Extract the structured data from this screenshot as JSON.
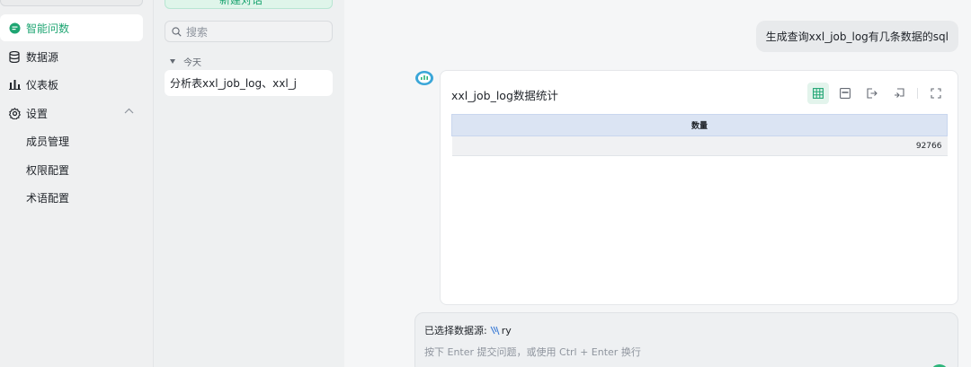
{
  "sidebar": {
    "items": [
      {
        "label": "智能问数",
        "icon": "chat-bubble-icon",
        "active": true
      },
      {
        "label": "数据源",
        "icon": "database-icon"
      },
      {
        "label": "仪表板",
        "icon": "bar-chart-icon"
      },
      {
        "label": "设置",
        "icon": "gear-icon"
      }
    ],
    "settings_sub": [
      "成员管理",
      "权限配置",
      "术语配置"
    ]
  },
  "history": {
    "new_chat_label": "新建对话",
    "search_placeholder": "搜索",
    "group_today": "今天",
    "items": [
      "分析表xxl_job_log、xxl_j"
    ]
  },
  "chat": {
    "user_message": "生成查询xxl_job_log有几条数据的sql",
    "answer": {
      "title": "xxl_job_log数据统计",
      "tools": [
        "table-view-icon",
        "sql-icon",
        "export-icon",
        "insert-dashboard-icon",
        "fullscreen-icon"
      ],
      "table": {
        "columns": [
          "数量"
        ],
        "rows": [
          [
            "92766"
          ]
        ]
      }
    },
    "input": {
      "datasource_prefix": "已选择数据源:",
      "datasource_name": "ry",
      "hint": "按下 Enter 提交问题，或使用 Ctrl + Enter 换行"
    }
  },
  "colors": {
    "accent": "#1ea572",
    "table_header": "#dbe4f3"
  }
}
